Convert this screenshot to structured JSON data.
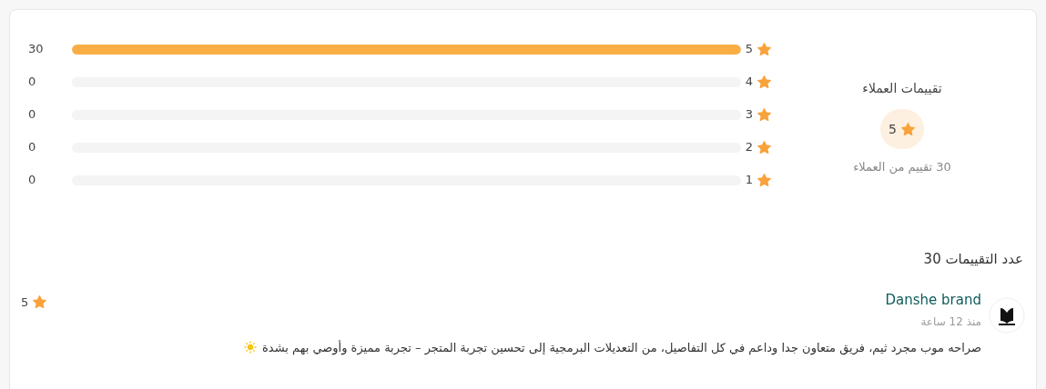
{
  "summary": {
    "title": "تقييمات العملاء",
    "average": "5",
    "count_text": "30 تقييم من العملاء"
  },
  "distribution": [
    {
      "rating": "5",
      "count": "30",
      "level": 1
    },
    {
      "rating": "4",
      "count": "0",
      "level": 0
    },
    {
      "rating": "3",
      "count": "0",
      "level": 0
    },
    {
      "rating": "2",
      "count": "0",
      "level": 0
    },
    {
      "rating": "1",
      "count": "0",
      "level": 0
    }
  ],
  "reviews_heading": "عدد التقييمات 30",
  "reviews": [
    {
      "author": "Danshe brand",
      "time": "منذ 12 ساعة",
      "rating": "5",
      "comment": "صراحه موب مجرد ثيم، فريق متعاون جدا وداعم في كل التفاصيل، من التعديلات البرمجية إلى تحسين تجربة المتجر – تجربة مميزة وأوصي بهم بشدة"
    }
  ]
}
